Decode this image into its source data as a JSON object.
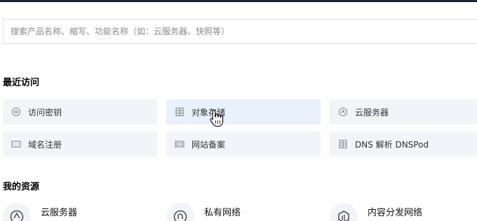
{
  "search": {
    "placeholder": "搜索产品名称、缩写、功能名称（如：云服务器、快照等）"
  },
  "recent": {
    "title": "最近访问",
    "items": [
      {
        "label": "访问密钥",
        "icon": "key-icon"
      },
      {
        "label": "对象存储",
        "icon": "storage-icon"
      },
      {
        "label": "云服务器",
        "icon": "server-icon"
      },
      {
        "label": "域名注册",
        "icon": "domain-icon"
      },
      {
        "label": "网站备案",
        "icon": "icp-icon"
      },
      {
        "label": "DNS 解析 DNSPod",
        "icon": "dns-icon"
      }
    ]
  },
  "resources": {
    "title": "我的资源",
    "items": [
      {
        "label": "云服务器",
        "icon": "server-icon"
      },
      {
        "label": "私有网络",
        "icon": "vpc-icon"
      },
      {
        "label": "内容分发网络",
        "icon": "cdn-icon"
      }
    ]
  },
  "colors": {
    "tile_bg": "#f2f4f8",
    "tile_hover_bg": "#e9f1fd",
    "topbar": "#1b2533"
  }
}
